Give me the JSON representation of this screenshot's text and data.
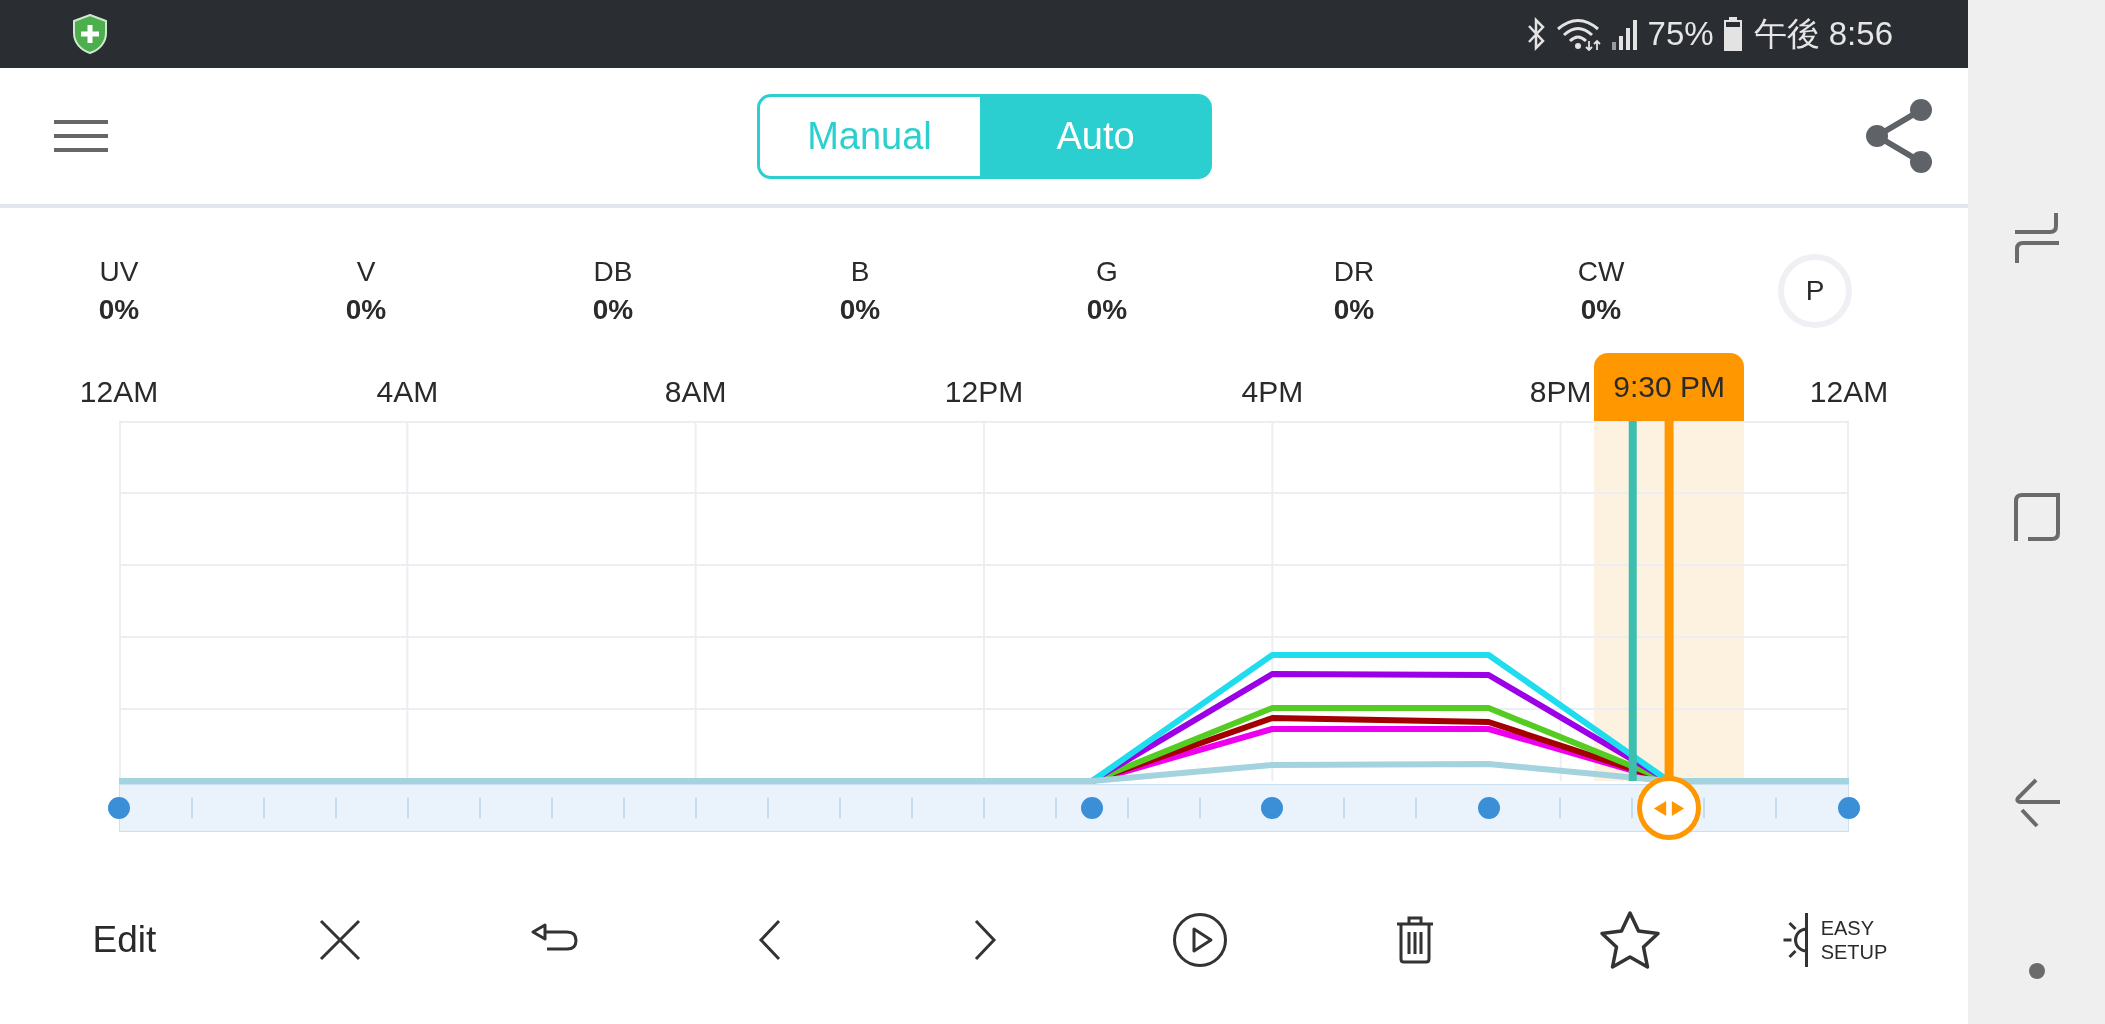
{
  "status_bar": {
    "battery": "75%",
    "clock": "午後 8:56"
  },
  "header": {
    "mode_tabs": [
      {
        "label": "Manual",
        "selected": false
      },
      {
        "label": "Auto",
        "selected": true
      }
    ]
  },
  "channels": [
    {
      "name": "UV",
      "value": "0%"
    },
    {
      "name": "V",
      "value": "0%"
    },
    {
      "name": "DB",
      "value": "0%"
    },
    {
      "name": "B",
      "value": "0%"
    },
    {
      "name": "G",
      "value": "0%"
    },
    {
      "name": "DR",
      "value": "0%"
    },
    {
      "name": "CW",
      "value": "0%"
    }
  ],
  "preset_button": {
    "label": "P"
  },
  "timeline": {
    "time_labels": [
      "12AM",
      "4AM",
      "8AM",
      "12PM",
      "4PM",
      "8PM",
      "12AM"
    ],
    "cursor": {
      "time": "9:30 PM",
      "level": 0.896
    }
  },
  "toolbar": {
    "edit": "Edit",
    "easy_setup": "EASY SETUP"
  }
}
